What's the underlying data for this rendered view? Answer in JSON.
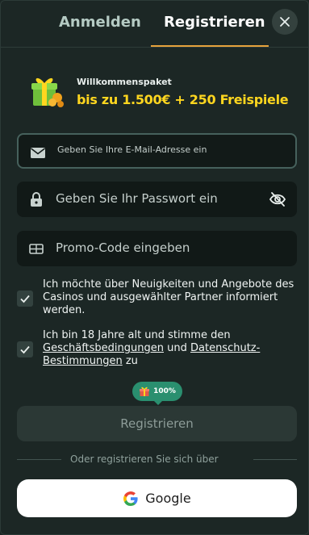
{
  "tabs": {
    "login": "Anmelden",
    "register": "Registrieren"
  },
  "welcome": {
    "title": "Willkommenspaket",
    "offer": "bis zu 1.500€ + 250 Freispiele"
  },
  "fields": {
    "email_placeholder": "Geben Sie Ihre E-Mail-Adresse ein",
    "password_placeholder": "Geben Sie Ihr Passwort ein",
    "promo_placeholder": "Promo-Code eingeben"
  },
  "consent": {
    "newsletter": "Ich möchte über Neuigkeiten und Angebote des Casinos und ausgewählter Partner informiert werden.",
    "age_prefix": "Ich bin 18 Jahre alt und stimme den ",
    "terms_link": "Geschäftsbedingungen",
    "and": " und ",
    "privacy_link": "Datenschutz-Bestimmungen",
    "age_suffix": " zu"
  },
  "progress": {
    "label": "100%",
    "value": 1.0
  },
  "buttons": {
    "register": "Registrieren",
    "google": "Google"
  },
  "separator": "Oder registrieren Sie sich über",
  "colors": {
    "accent": "#e6a23c",
    "offer": "#ffd61f",
    "badge": "#2a8f6f"
  }
}
